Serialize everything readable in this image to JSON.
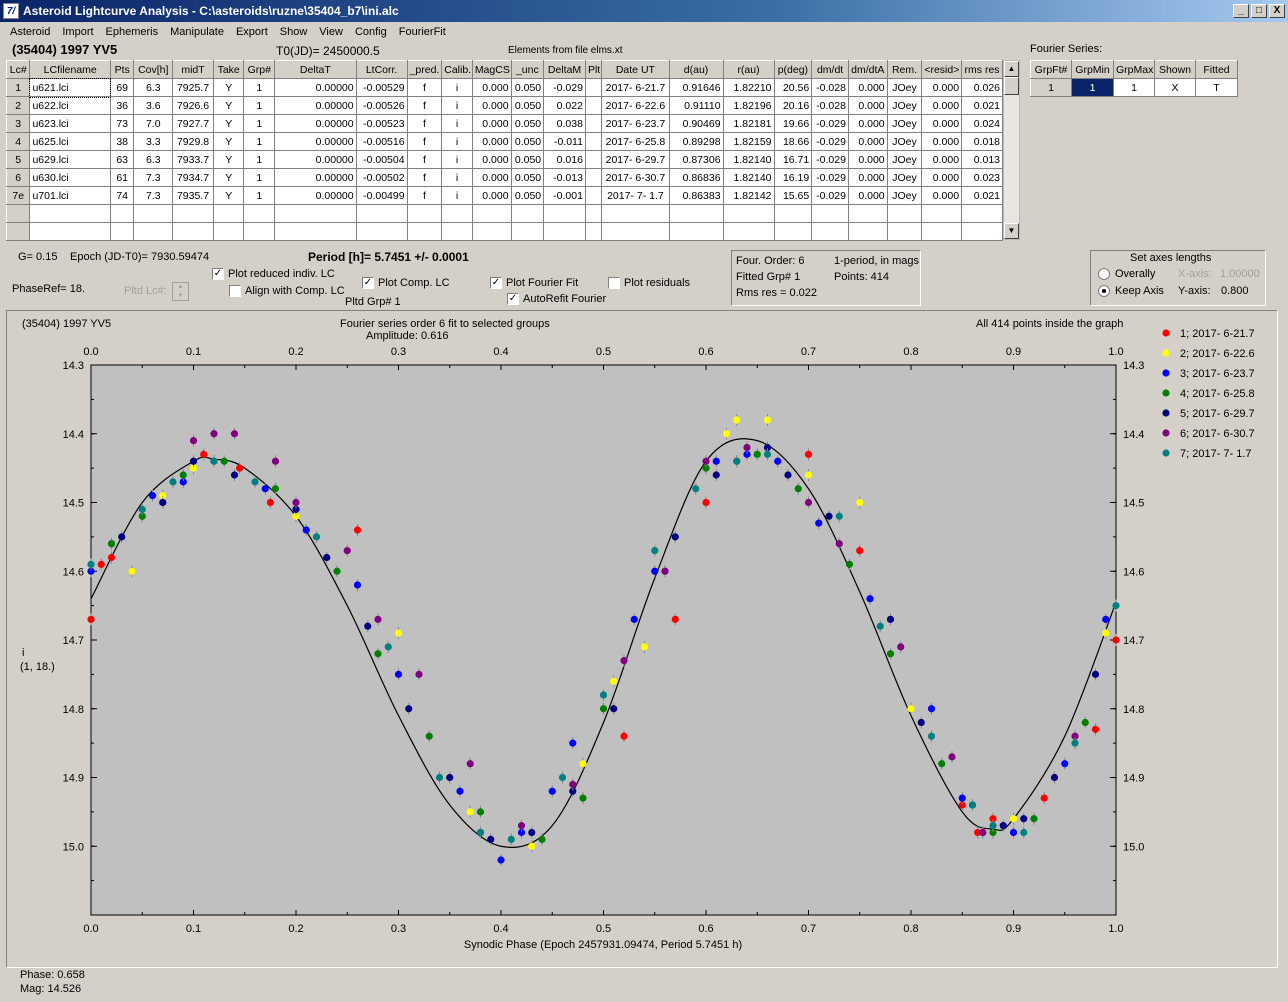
{
  "window": {
    "icon": "alc-app-icon",
    "title": "Asteroid Lightcurve Analysis - C:\\asteroids\\ruzne\\35404_b7\\ini.alc",
    "buttons": [
      "_",
      "□",
      "X"
    ]
  },
  "menu": [
    "Asteroid",
    "Import",
    "Ephemeris",
    "Manipulate",
    "Export",
    "Show",
    "View",
    "Config",
    "FourierFit"
  ],
  "header": {
    "object": "(35404) 1997 YV5",
    "t0": "T0(JD)= 2450000.5",
    "elements": "Elements from file elms.xt",
    "fourier_title": "Fourier Series:"
  },
  "lc_table": {
    "columns": [
      "Lc#",
      "LCfilename",
      "Pts",
      "Cov[h]",
      "midT",
      "Take",
      "Grp#",
      "DeltaT",
      "LtCorr.",
      "_pred.",
      "Calib.",
      "MagCS",
      "_unc",
      "DeltaM",
      "Plt",
      "Date UT",
      "d(au)",
      "r(au)",
      "p(deg)",
      "dm/dt",
      "dm/dtA",
      "Rem.",
      "<resid>",
      "rms res"
    ],
    "rows": [
      [
        "1",
        "u621.lci",
        "69",
        "6.3",
        "7925.7",
        "Y",
        "1",
        "0.00000",
        "-0.00529",
        "f",
        "i",
        "0.000",
        "0.050",
        "-0.029",
        "",
        "2017- 6-21.7",
        "0.91646",
        "1.82210",
        "20.56",
        "-0.028",
        "0.000",
        "JOey",
        "0.000",
        "0.026"
      ],
      [
        "2",
        "u622.lci",
        "36",
        "3.6",
        "7926.6",
        "Y",
        "1",
        "0.00000",
        "-0.00526",
        "f",
        "i",
        "0.000",
        "0.050",
        "0.022",
        "",
        "2017- 6-22.6",
        "0.91110",
        "1.82196",
        "20.16",
        "-0.028",
        "0.000",
        "JOey",
        "0.000",
        "0.021"
      ],
      [
        "3",
        "u623.lci",
        "73",
        "7.0",
        "7927.7",
        "Y",
        "1",
        "0.00000",
        "-0.00523",
        "f",
        "i",
        "0.000",
        "0.050",
        "0.038",
        "",
        "2017- 6-23.7",
        "0.90469",
        "1.82181",
        "19.66",
        "-0.029",
        "0.000",
        "JOey",
        "0.000",
        "0.024"
      ],
      [
        "4",
        "u625.lci",
        "38",
        "3.3",
        "7929.8",
        "Y",
        "1",
        "0.00000",
        "-0.00516",
        "f",
        "i",
        "0.000",
        "0.050",
        "-0.011",
        "",
        "2017- 6-25.8",
        "0.89298",
        "1.82159",
        "18.66",
        "-0.029",
        "0.000",
        "JOey",
        "0.000",
        "0.018"
      ],
      [
        "5",
        "u629.lci",
        "63",
        "6.3",
        "7933.7",
        "Y",
        "1",
        "0.00000",
        "-0.00504",
        "f",
        "i",
        "0.000",
        "0.050",
        "0.016",
        "",
        "2017- 6-29.7",
        "0.87306",
        "1.82140",
        "16.71",
        "-0.029",
        "0.000",
        "JOey",
        "0.000",
        "0.013"
      ],
      [
        "6",
        "u630.lci",
        "61",
        "7.3",
        "7934.7",
        "Y",
        "1",
        "0.00000",
        "-0.00502",
        "f",
        "i",
        "0.000",
        "0.050",
        "-0.013",
        "",
        "2017- 6-30.7",
        "0.86836",
        "1.82140",
        "16.19",
        "-0.029",
        "0.000",
        "JOey",
        "0.000",
        "0.023"
      ],
      [
        "7e",
        "u701.lci",
        "74",
        "7.3",
        "7935.7",
        "Y",
        "1",
        "0.00000",
        "-0.00499",
        "f",
        "i",
        "0.000",
        "0.050",
        "-0.001",
        "",
        "2017- 7- 1.7",
        "0.86383",
        "1.82142",
        "15.65",
        "-0.029",
        "0.000",
        "JOey",
        "0.000",
        "0.021"
      ]
    ]
  },
  "fourier_table": {
    "columns": [
      "GrpFt#",
      "GrpMin",
      "GrpMax",
      "Shown",
      "Fitted"
    ],
    "row": [
      "1",
      "1",
      "1",
      "X",
      "T"
    ]
  },
  "controls": {
    "g": "G= 0.15",
    "epoch": "Epoch (JD-T0)= 7930.59474",
    "period": "Period [h]= 5.7451 +/- 0.0001",
    "phaseref": "PhaseRef= 18.",
    "pltd_lc": "Pltd Lc#:",
    "pltd_grp": "Pltd Grp#  1",
    "plot_reduced": "Plot reduced indiv. LC",
    "align_comp": "Align with Comp. LC",
    "plot_comp": "Plot Comp. LC",
    "plot_fourier": "Plot Fourier Fit",
    "autorefit": "AutoRefit Fourier",
    "plot_residuals": "Plot residuals"
  },
  "fit_info": {
    "order": "Four. Order:  6",
    "mode": "1-period, in mags",
    "fitted": "Fitted Grp# 1",
    "points": "Points: 414",
    "rms": "Rms res     = 0.022"
  },
  "axes_box": {
    "title": "Set axes lengths",
    "overally": "Overally",
    "keep": "Keep Axis",
    "xlabel": "X-axis:",
    "xval": "1.00000",
    "ylabel": "Y-axis:",
    "yval": "0.800"
  },
  "plot": {
    "object": "(35404) 1997 YV5",
    "fit_title": "Fourier series order 6 fit to selected groups",
    "amplitude": "Amplitude: 0.616",
    "inside": "All 414 points inside the graph",
    "ylabel1": "i",
    "ylabel2": "(1, 18.)"
  },
  "status": {
    "phase": "Phase:  0.658",
    "mag": "Mag:    14.526"
  },
  "chart_data": {
    "type": "scatter",
    "xlabel": "Synodic Phase (Epoch 2457931.09474, Period 5.7451 h)",
    "xlim": [
      0,
      1
    ],
    "ylim": [
      15.1,
      14.3
    ],
    "y_inverted": true,
    "xticks": [
      "0.0",
      "0.1",
      "0.2",
      "0.3",
      "0.4",
      "0.5",
      "0.6",
      "0.7",
      "0.8",
      "0.9",
      "1.0"
    ],
    "yticks": [
      "14.3",
      "14.4",
      "14.5",
      "14.6",
      "14.7",
      "14.8",
      "14.9",
      "15.0"
    ],
    "legend_position": "right",
    "fourier_fit": {
      "phase": [
        0,
        0.05,
        0.1,
        0.12,
        0.15,
        0.2,
        0.25,
        0.3,
        0.35,
        0.4,
        0.45,
        0.5,
        0.55,
        0.6,
        0.65,
        0.7,
        0.75,
        0.8,
        0.85,
        0.88,
        0.9,
        0.95,
        1.0
      ],
      "mag": [
        14.64,
        14.5,
        14.44,
        14.437,
        14.45,
        14.52,
        14.65,
        14.81,
        14.94,
        15.0,
        14.97,
        14.82,
        14.61,
        14.44,
        14.41,
        14.48,
        14.63,
        14.81,
        14.95,
        14.975,
        14.96,
        14.84,
        14.645
      ]
    },
    "series": [
      {
        "name": "1; 2017- 6-21.7",
        "color": "#ff0000",
        "x": [
          0.0,
          0.01,
          0.02,
          0.04,
          0.07,
          0.11,
          0.145,
          0.175,
          0.26,
          0.52,
          0.57,
          0.6,
          0.63,
          0.7,
          0.75,
          0.85,
          0.865,
          0.88,
          0.93,
          0.98,
          1.0
        ],
        "y": [
          14.67,
          14.59,
          14.58,
          14.6,
          14.5,
          14.43,
          14.45,
          14.5,
          14.54,
          14.84,
          14.67,
          14.5,
          14.44,
          14.43,
          14.57,
          14.94,
          14.98,
          14.96,
          14.93,
          14.83,
          14.7
        ]
      },
      {
        "name": "2; 2017- 6-22.6",
        "color": "#ffff00",
        "x": [
          0.04,
          0.07,
          0.1,
          0.12,
          0.2,
          0.3,
          0.37,
          0.43,
          0.48,
          0.51,
          0.54,
          0.6,
          0.62,
          0.63,
          0.66,
          0.7,
          0.75,
          0.8,
          0.9,
          0.99
        ],
        "y": [
          14.6,
          14.49,
          14.45,
          14.44,
          14.52,
          14.69,
          14.95,
          15.0,
          14.88,
          14.76,
          14.71,
          14.45,
          14.4,
          14.38,
          14.38,
          14.46,
          14.5,
          14.8,
          14.96,
          14.69
        ]
      },
      {
        "name": "3; 2017- 6-23.7",
        "color": "#0000ff",
        "x": [
          0.0,
          0.02,
          0.06,
          0.09,
          0.12,
          0.17,
          0.21,
          0.26,
          0.3,
          0.36,
          0.38,
          0.4,
          0.42,
          0.45,
          0.47,
          0.53,
          0.55,
          0.61,
          0.64,
          0.67,
          0.71,
          0.76,
          0.82,
          0.85,
          0.87,
          0.9,
          0.95,
          0.99
        ],
        "y": [
          14.6,
          14.56,
          14.49,
          14.47,
          14.44,
          14.48,
          14.54,
          14.62,
          14.75,
          14.92,
          14.98,
          15.02,
          14.98,
          14.92,
          14.85,
          14.67,
          14.6,
          14.44,
          14.43,
          14.44,
          14.53,
          14.64,
          14.8,
          14.93,
          14.98,
          14.98,
          14.88,
          14.67
        ]
      },
      {
        "name": "4; 2017- 6-25.8",
        "color": "#008000",
        "x": [
          0.02,
          0.05,
          0.09,
          0.13,
          0.18,
          0.24,
          0.28,
          0.33,
          0.38,
          0.44,
          0.48,
          0.5,
          0.56,
          0.6,
          0.65,
          0.69,
          0.74,
          0.78,
          0.83,
          0.88,
          0.92,
          0.97
        ],
        "y": [
          14.56,
          14.52,
          14.46,
          14.44,
          14.48,
          14.6,
          14.72,
          14.84,
          14.95,
          14.99,
          14.93,
          14.8,
          14.6,
          14.45,
          14.43,
          14.48,
          14.59,
          14.72,
          14.88,
          14.98,
          14.96,
          14.82
        ]
      },
      {
        "name": "5; 2017- 6-29.7",
        "color": "#000080",
        "x": [
          0.03,
          0.07,
          0.1,
          0.14,
          0.2,
          0.23,
          0.27,
          0.31,
          0.35,
          0.39,
          0.43,
          0.47,
          0.51,
          0.57,
          0.61,
          0.66,
          0.68,
          0.72,
          0.78,
          0.81,
          0.86,
          0.89,
          0.91,
          0.94,
          0.98
        ],
        "y": [
          14.55,
          14.5,
          14.44,
          14.46,
          14.51,
          14.58,
          14.68,
          14.8,
          14.9,
          14.99,
          14.98,
          14.92,
          14.8,
          14.55,
          14.46,
          14.42,
          14.46,
          14.52,
          14.67,
          14.82,
          14.94,
          14.97,
          14.96,
          14.9,
          14.75
        ]
      },
      {
        "name": "6; 2017- 6-30.7",
        "color": "#800080",
        "x": [
          0.1,
          0.12,
          0.14,
          0.18,
          0.2,
          0.25,
          0.28,
          0.32,
          0.37,
          0.42,
          0.47,
          0.52,
          0.56,
          0.6,
          0.64,
          0.7,
          0.73,
          0.79,
          0.84,
          0.87,
          0.96
        ],
        "y": [
          14.41,
          14.4,
          14.4,
          14.44,
          14.5,
          14.57,
          14.67,
          14.75,
          14.88,
          14.97,
          14.91,
          14.73,
          14.6,
          14.44,
          14.42,
          14.5,
          14.56,
          14.71,
          14.87,
          14.98,
          14.84
        ]
      },
      {
        "name": "7; 2017- 7- 1.7",
        "color": "#008080",
        "x": [
          0.0,
          0.05,
          0.08,
          0.12,
          0.16,
          0.22,
          0.29,
          0.34,
          0.38,
          0.41,
          0.46,
          0.5,
          0.55,
          0.59,
          0.63,
          0.66,
          0.73,
          0.77,
          0.82,
          0.86,
          0.88,
          0.91,
          0.96,
          1.0
        ],
        "y": [
          14.59,
          14.51,
          14.47,
          14.44,
          14.47,
          14.55,
          14.71,
          14.9,
          14.98,
          14.99,
          14.9,
          14.78,
          14.57,
          14.48,
          14.44,
          14.43,
          14.52,
          14.68,
          14.84,
          14.94,
          14.97,
          14.98,
          14.85,
          14.65
        ]
      }
    ]
  }
}
